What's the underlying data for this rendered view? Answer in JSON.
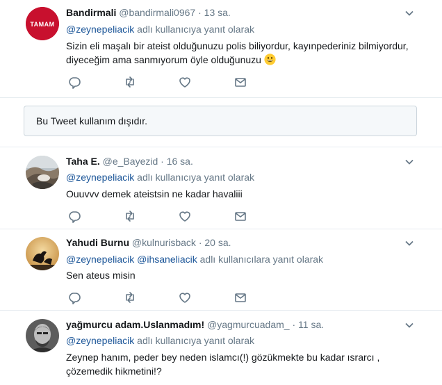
{
  "tweets": [
    {
      "name": "Bandirmali",
      "handle": "@bandirmali0967",
      "dot": "·",
      "time": "13 sa.",
      "avatar_text": "TAMAM",
      "reply_mentions": "@zeynepeliacik",
      "reply_suffix": " adlı kullanıcıya yanıt olarak",
      "text_line1": "Sizin eli maşalı bir ateist olduğunuzu polis biliyordur, kayınpederiniz bilmiyordur,",
      "text_line2": "diyeceğim ama sanmıyorum öyle olduğunuzu"
    },
    {
      "name": "Taha E.",
      "handle": "@e_Bayezid",
      "dot": "·",
      "time": "16 sa.",
      "reply_mentions": "@zeynepeliacik",
      "reply_suffix": " adlı kullanıcıya yanıt olarak",
      "text_line1": "Ouuvvv demek ateistsin ne kadar havaliii"
    },
    {
      "name": "Yahudi Burnu",
      "handle": "@kulnurisback",
      "dot": "·",
      "time": "20 sa.",
      "reply_mentions": "@zeynepeliacik @ihsaneliacik",
      "reply_suffix": " adlı kullanıcılara yanıt olarak",
      "text_line1": "Sen ateus misin"
    },
    {
      "name": "yağmurcu adam.Uslanmadım!",
      "handle": "@yagmurcuadam_",
      "dot": "·",
      "time": "11 sa.",
      "reply_mentions": "@zeynepeliacik",
      "reply_suffix": " adlı kullanıcıya yanıt olarak",
      "text_line1": "Zeynep hanım, peder bey neden islamcı(!) gözükmekte bu kadar ısrarcı ,",
      "text_line2": "çözemedik hikmetini!?"
    }
  ],
  "notice": {
    "text": "Bu Tweet kullanım dışıdır."
  },
  "icons": {
    "reply": "reply-icon",
    "retweet": "retweet-icon",
    "like": "heart-icon",
    "dm": "envelope-icon",
    "more": "chevron-down-icon"
  },
  "colors": {
    "link": "#1b5598",
    "muted": "#657786",
    "border": "#e6ecf0",
    "avatar_red": "#c8102e"
  }
}
